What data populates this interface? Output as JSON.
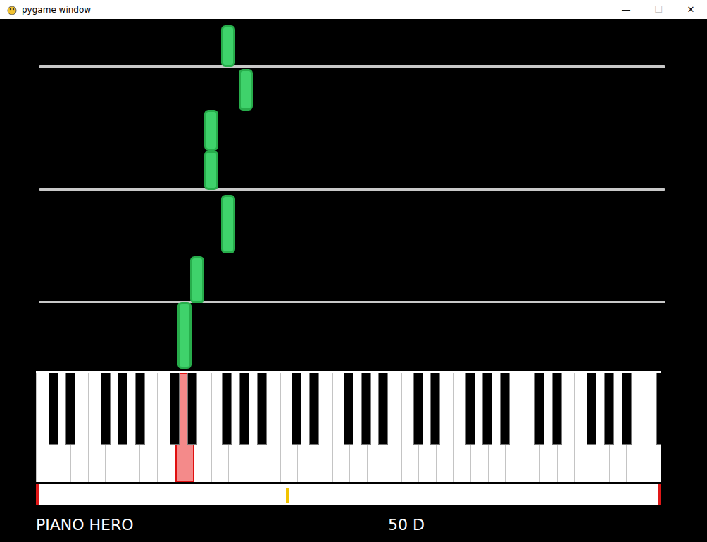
{
  "window": {
    "title": "pygame window",
    "controls": [
      "—",
      "☐",
      "✕"
    ]
  },
  "bar_lines": [
    9.6,
    25.6,
    43.0
  ],
  "notes": [
    {
      "column": 10.66,
      "start": 43.2,
      "length": 5.9
    },
    {
      "column": 11.67,
      "start": 37.0,
      "length": 5.9
    },
    {
      "column": 9.69,
      "start": 31.3,
      "length": 5.8
    },
    {
      "column": 9.69,
      "start": 25.7,
      "length": 5.6
    },
    {
      "column": 10.66,
      "start": 16.7,
      "length": 8.3
    },
    {
      "column": 8.88,
      "start": 9.6,
      "length": 6.7
    },
    {
      "column": 8.15,
      "start": 0.3,
      "length": 9.5
    }
  ],
  "keyboard": {
    "white_keys": [
      {
        "pressed": false
      },
      {
        "pressed": false
      },
      {
        "pressed": false
      },
      {
        "pressed": false
      },
      {
        "pressed": false
      },
      {
        "pressed": false
      },
      {
        "pressed": false
      },
      {
        "pressed": false
      },
      {
        "pressed": true
      },
      {
        "pressed": false
      },
      {
        "pressed": false
      },
      {
        "pressed": false
      },
      {
        "pressed": false
      },
      {
        "pressed": false
      },
      {
        "pressed": false
      },
      {
        "pressed": false
      },
      {
        "pressed": false
      },
      {
        "pressed": false
      },
      {
        "pressed": false
      },
      {
        "pressed": false
      },
      {
        "pressed": false
      },
      {
        "pressed": false
      },
      {
        "pressed": false
      },
      {
        "pressed": false
      },
      {
        "pressed": false
      },
      {
        "pressed": false
      },
      {
        "pressed": false
      },
      {
        "pressed": false
      },
      {
        "pressed": false
      },
      {
        "pressed": false
      },
      {
        "pressed": false
      },
      {
        "pressed": false
      },
      {
        "pressed": false
      },
      {
        "pressed": false
      },
      {
        "pressed": false
      },
      {
        "pressed": false
      }
    ]
  },
  "progress": {
    "level": 0.4
  },
  "footer": {
    "title": "PIANO HERO",
    "score": "50 D"
  }
}
